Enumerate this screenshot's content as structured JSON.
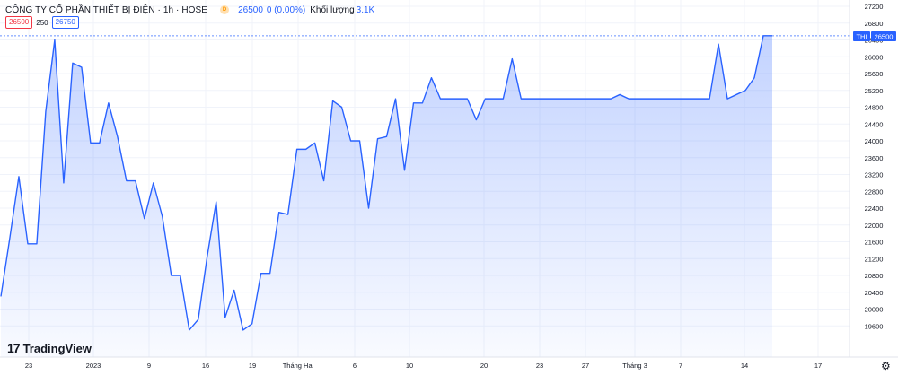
{
  "header": {
    "title": "CÔNG TY CỔ PHẦN THIẾT BỊ ĐIỆN · 1h · HOSE",
    "badge": "D",
    "price": "26500",
    "change": "0 (0.00%)",
    "volume_label": "Khối lượng",
    "volume_value": "3.1K"
  },
  "chips": {
    "sell": "26500",
    "spread": "250",
    "buy": "26750"
  },
  "brand": {
    "name": "TradingView",
    "logo_text": "17"
  },
  "colors": {
    "line": "#2962ff",
    "fill": "#2962ff",
    "tag": "#2962ff",
    "grid": "#f0f3fa",
    "text": "#131722"
  },
  "chart_data": {
    "type": "area",
    "symbol_tag": "THI",
    "last_value": 26500,
    "ylim": [
      19200,
      27200
    ],
    "y_ticks": [
      19600,
      20000,
      20400,
      20800,
      21200,
      21600,
      22000,
      22400,
      22800,
      23200,
      23600,
      24000,
      24400,
      24800,
      25200,
      25600,
      26000,
      26400,
      26800,
      27200
    ],
    "x_ticks": [
      "23",
      "2023",
      "9",
      "16",
      "19",
      "Tháng Hai",
      "6",
      "10",
      "20",
      "23",
      "27",
      "Tháng 3",
      "7",
      "14",
      "17"
    ],
    "grid": true,
    "values": [
      20300,
      21700,
      23150,
      21550,
      21550,
      24700,
      26400,
      23000,
      25850,
      25750,
      23950,
      23950,
      24900,
      24100,
      23050,
      23050,
      22150,
      23000,
      22200,
      20800,
      20800,
      19500,
      19750,
      21250,
      22550,
      19800,
      20450,
      19500,
      19650,
      20850,
      20850,
      22300,
      22250,
      23800,
      23800,
      23950,
      23050,
      24950,
      24800,
      24000,
      24000,
      22400,
      24050,
      24100,
      25000,
      23300,
      24900,
      24900,
      25500,
      25000,
      25000,
      25000,
      25000,
      24500,
      25000,
      25000,
      25000,
      25950,
      25000,
      25000,
      25000,
      25000,
      25000,
      25000,
      25000,
      25000,
      25000,
      25000,
      25000,
      25100,
      25000,
      25000,
      25000,
      25000,
      25000,
      25000,
      25000,
      25000,
      25000,
      25000,
      26300,
      25000,
      25100,
      25200,
      25500,
      26500,
      26500
    ]
  }
}
